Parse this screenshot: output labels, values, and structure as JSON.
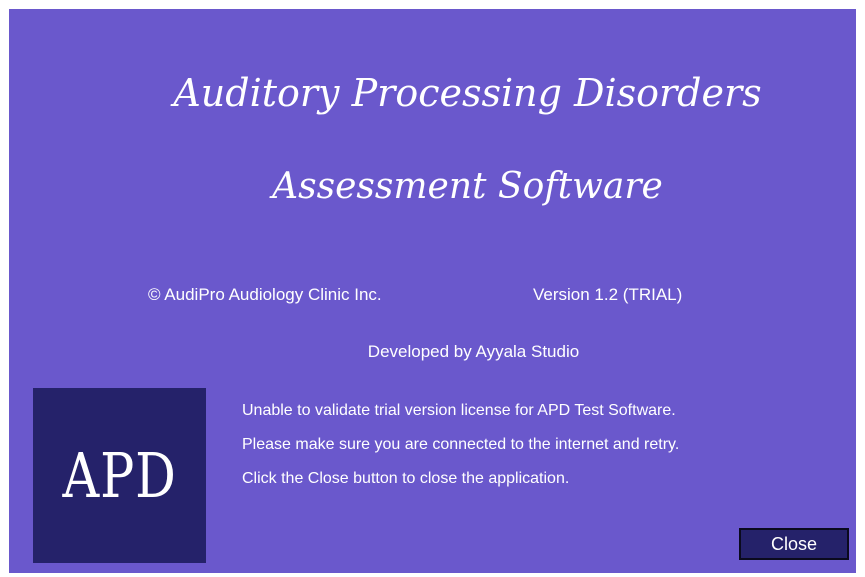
{
  "dialog": {
    "title_line_1": "Auditory Processing Disorders",
    "title_line_2": "Assessment Software",
    "copyright": "© AudiPro Audiology Clinic Inc.",
    "version": "Version 1.2 (TRIAL)",
    "developer": "Developed by Ayyala Studio",
    "logo_text": "APD",
    "messages": [
      "Unable to validate trial version license for APD Test Software.",
      "Please make sure you are connected to the internet and retry.",
      "Click the Close button to close the application."
    ],
    "close_label": "Close"
  },
  "colors": {
    "background": "#6a58cc",
    "logo_background": "#25226a",
    "button_background": "#25226a",
    "text": "#ffffff"
  }
}
